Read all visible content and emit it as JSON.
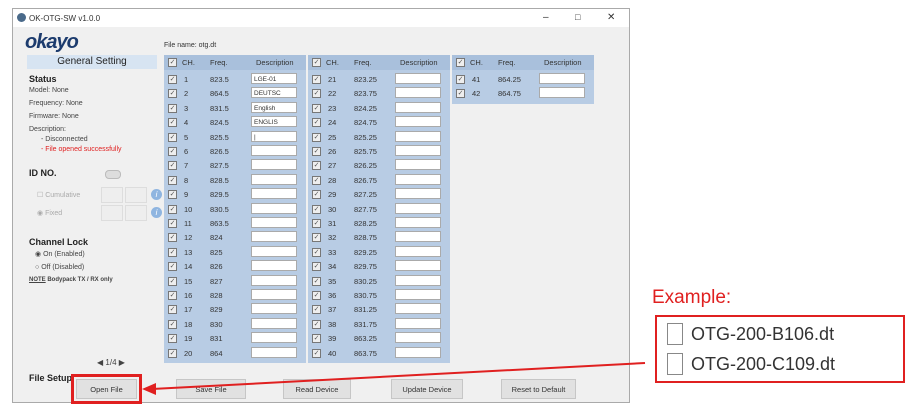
{
  "window": {
    "title": "OK-OTG-SW v1.0.0",
    "minimize": "–",
    "maximize": "□",
    "close": "✕"
  },
  "logo": "okayo",
  "file_name": "File name: otg.dt",
  "left": {
    "heading": "General Setting",
    "status": "Status",
    "model": "Model:  None",
    "frequency": "Frequency:  None",
    "firmware": "Firmware:    None",
    "description": "Description:",
    "desc1": "- Disconnected",
    "desc2": "- File opened successfully",
    "id_no": "ID NO.",
    "cumulative": "Cumulative",
    "fixed": "Fixed",
    "info": "i",
    "channel_lock": "Channel Lock",
    "on": "On (Enabled)",
    "off": "Off (Disabled)",
    "note_label": "NOTE",
    "note": " Bodypack TX / RX only",
    "page": "1/4",
    "prev": "◀",
    "next": "▶",
    "file_setup": "File Setup"
  },
  "table_headers": {
    "ch": "CH.",
    "freq": "Freq.",
    "desc": "Description"
  },
  "channels": [
    {
      "ch": "1",
      "freq": "823.5",
      "desc": "LGE-01"
    },
    {
      "ch": "2",
      "freq": "864.5",
      "desc": "DEUTSC"
    },
    {
      "ch": "3",
      "freq": "831.5",
      "desc": "English"
    },
    {
      "ch": "4",
      "freq": "824.5",
      "desc": "ENGLIS"
    },
    {
      "ch": "5",
      "freq": "825.5",
      "desc": "|"
    },
    {
      "ch": "6",
      "freq": "826.5",
      "desc": ""
    },
    {
      "ch": "7",
      "freq": "827.5",
      "desc": ""
    },
    {
      "ch": "8",
      "freq": "828.5",
      "desc": ""
    },
    {
      "ch": "9",
      "freq": "829.5",
      "desc": ""
    },
    {
      "ch": "10",
      "freq": "830.5",
      "desc": ""
    },
    {
      "ch": "11",
      "freq": "863.5",
      "desc": ""
    },
    {
      "ch": "12",
      "freq": "824",
      "desc": ""
    },
    {
      "ch": "13",
      "freq": "825",
      "desc": ""
    },
    {
      "ch": "14",
      "freq": "826",
      "desc": ""
    },
    {
      "ch": "15",
      "freq": "827",
      "desc": ""
    },
    {
      "ch": "16",
      "freq": "828",
      "desc": ""
    },
    {
      "ch": "17",
      "freq": "829",
      "desc": ""
    },
    {
      "ch": "18",
      "freq": "830",
      "desc": ""
    },
    {
      "ch": "19",
      "freq": "831",
      "desc": ""
    },
    {
      "ch": "20",
      "freq": "864",
      "desc": ""
    },
    {
      "ch": "21",
      "freq": "823.25",
      "desc": ""
    },
    {
      "ch": "22",
      "freq": "823.75",
      "desc": ""
    },
    {
      "ch": "23",
      "freq": "824.25",
      "desc": ""
    },
    {
      "ch": "24",
      "freq": "824.75",
      "desc": ""
    },
    {
      "ch": "25",
      "freq": "825.25",
      "desc": ""
    },
    {
      "ch": "26",
      "freq": "825.75",
      "desc": ""
    },
    {
      "ch": "27",
      "freq": "826.25",
      "desc": ""
    },
    {
      "ch": "28",
      "freq": "826.75",
      "desc": ""
    },
    {
      "ch": "29",
      "freq": "827.25",
      "desc": ""
    },
    {
      "ch": "30",
      "freq": "827.75",
      "desc": ""
    },
    {
      "ch": "31",
      "freq": "828.25",
      "desc": ""
    },
    {
      "ch": "32",
      "freq": "828.75",
      "desc": ""
    },
    {
      "ch": "33",
      "freq": "829.25",
      "desc": ""
    },
    {
      "ch": "34",
      "freq": "829.75",
      "desc": ""
    },
    {
      "ch": "35",
      "freq": "830.25",
      "desc": ""
    },
    {
      "ch": "36",
      "freq": "830.75",
      "desc": ""
    },
    {
      "ch": "37",
      "freq": "831.25",
      "desc": ""
    },
    {
      "ch": "38",
      "freq": "831.75",
      "desc": ""
    },
    {
      "ch": "39",
      "freq": "863.25",
      "desc": ""
    },
    {
      "ch": "40",
      "freq": "863.75",
      "desc": ""
    },
    {
      "ch": "41",
      "freq": "864.25",
      "desc": ""
    },
    {
      "ch": "42",
      "freq": "864.75",
      "desc": ""
    }
  ],
  "buttons": {
    "open": "Open File",
    "save": "Save File",
    "read": "Read Device",
    "update": "Update Device",
    "reset": "Reset to Default"
  },
  "example": {
    "label": "Example:",
    "files": [
      "OTG-200-B106.dt",
      "OTG-200-C109.dt"
    ]
  },
  "colors": {
    "accent": "#e02020",
    "table": "#b8cce4"
  }
}
